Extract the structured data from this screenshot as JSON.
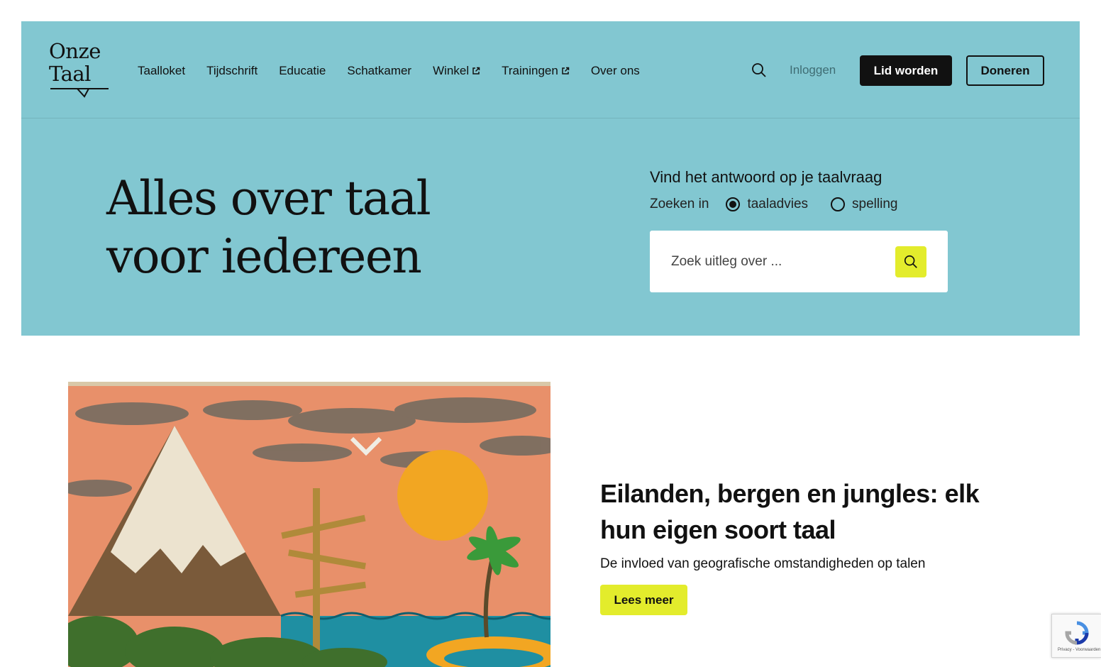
{
  "header": {
    "logo_line1": "Onze",
    "logo_line2": "Taal",
    "nav": [
      {
        "label": "Taalloket",
        "external": false
      },
      {
        "label": "Tijdschrift",
        "external": false
      },
      {
        "label": "Educatie",
        "external": false
      },
      {
        "label": "Schatkamer",
        "external": false
      },
      {
        "label": "Winkel",
        "external": true
      },
      {
        "label": "Trainingen",
        "external": true
      },
      {
        "label": "Over ons",
        "external": false
      }
    ],
    "search_icon": "search-icon",
    "login_label": "Inloggen",
    "join_label": "Lid worden",
    "donate_label": "Doneren"
  },
  "hero": {
    "title_line1": "Alles over taal",
    "title_line2": "voor iedereen",
    "search_heading": "Vind het antwoord op je taalvraag",
    "scope_label": "Zoeken in",
    "scope_options": [
      {
        "label": "taaladvies",
        "selected": true
      },
      {
        "label": "spelling",
        "selected": false
      }
    ],
    "search_placeholder": "Zoek uitleg over ..."
  },
  "feature": {
    "title": "Eilanden, bergen en jungles: elk hun eigen soort taal",
    "subtitle": "De invloed van geografische omstandigheden op talen",
    "button_label": "Lees meer"
  },
  "recaptcha": {
    "text": "Privacy - Voorwaarden"
  },
  "colors": {
    "header_bg": "#82c7d1",
    "accent_yellow": "#e3ec2c",
    "dark": "#111111"
  }
}
